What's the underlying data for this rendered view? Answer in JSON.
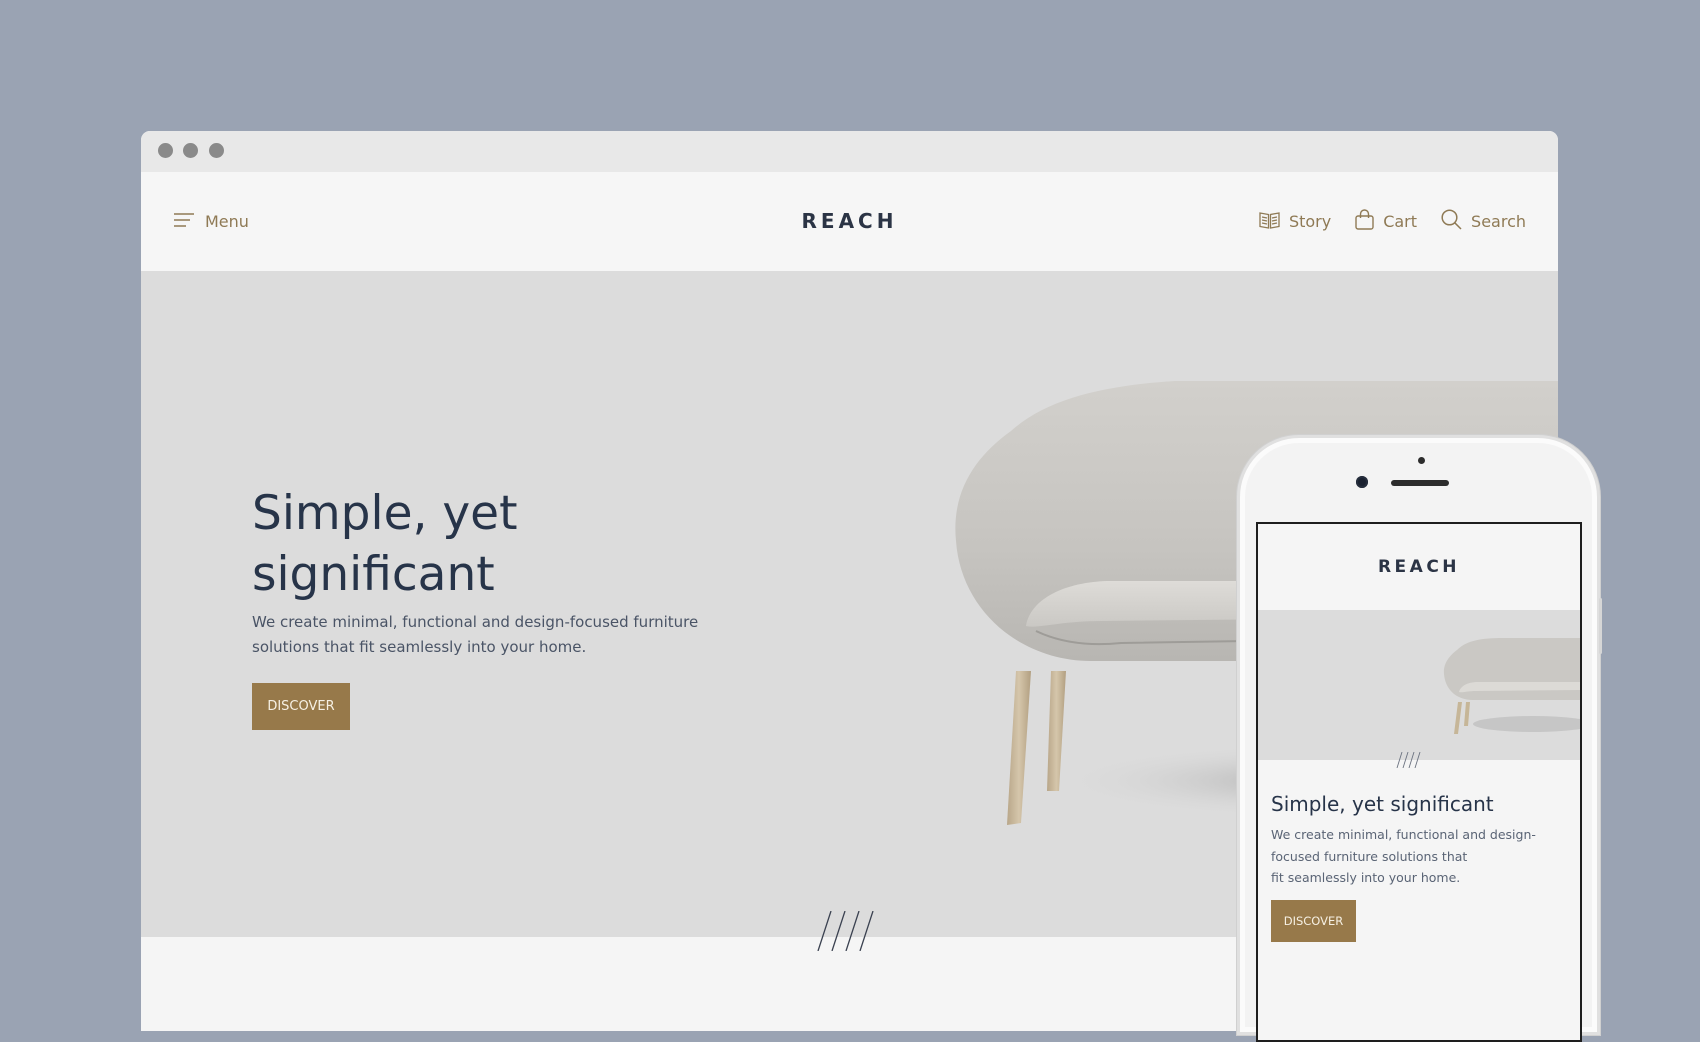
{
  "window": {
    "controls": [
      "close",
      "minimize",
      "maximize"
    ]
  },
  "header": {
    "menu_label": "Menu",
    "menu_icon": "hamburger-menu-icon",
    "logo": "REACH",
    "nav": [
      {
        "label": "Story",
        "icon": "open-book-icon"
      },
      {
        "label": "Cart",
        "icon": "shopping-bag-icon"
      },
      {
        "label": "Search",
        "icon": "search-icon"
      }
    ]
  },
  "hero": {
    "title_line1": "Simple, yet",
    "title_line2": "significant",
    "description": "We create minimal, functional and design-focused furniture solutions that fit seamlessly into your home.",
    "cta_label": "DISCOVER",
    "image": "grey-upholstered-sofa-with-wooden-legs"
  },
  "mobile": {
    "logo": "REACH",
    "title": "Simple, yet significant",
    "description_line1": "We create minimal, functional and design-",
    "description_line2": "focused furniture solutions that",
    "description_line3": "fit seamlessly into your home.",
    "cta_label": "DISCOVER"
  },
  "colors": {
    "background": "#9aa3b3",
    "accent": "#97794a",
    "nav_text": "#8f7a55",
    "heading": "#273449",
    "hero_bg": "#dcdcdc"
  }
}
